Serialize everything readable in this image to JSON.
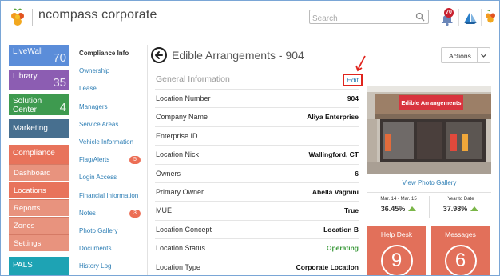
{
  "header": {
    "brand": "ncompass corporate",
    "search_placeholder": "Search",
    "notification_count": "70"
  },
  "nav_tiles": [
    {
      "label": "LiveWall",
      "count": "70",
      "color": "#5b8dd9"
    },
    {
      "label": "Library",
      "count": "35",
      "color": "#8c5db2"
    },
    {
      "label": "Solution Center",
      "count": "4",
      "color": "#3e9a4f"
    },
    {
      "label": "Marketing",
      "count": "",
      "color": "#476f8f"
    },
    {
      "label": "Compliance",
      "count": "",
      "color": "#e8735b"
    },
    {
      "label": "PALS",
      "count": "",
      "color": "#1ea3b4"
    }
  ],
  "compliance_subitems": [
    "Dashboard",
    "Locations",
    "Reports",
    "Zones",
    "Settings"
  ],
  "subnav": [
    {
      "label": "Compliance Info",
      "count": ""
    },
    {
      "label": "Ownership",
      "count": ""
    },
    {
      "label": "Lease",
      "count": ""
    },
    {
      "label": "Managers",
      "count": ""
    },
    {
      "label": "Service Areas",
      "count": ""
    },
    {
      "label": "Vehicle Information",
      "count": ""
    },
    {
      "label": "Flag/Alerts",
      "count": "5"
    },
    {
      "label": "Login Access",
      "count": ""
    },
    {
      "label": "Financial Information",
      "count": ""
    },
    {
      "label": "Notes",
      "count": "3"
    },
    {
      "label": "Photo Gallery",
      "count": ""
    },
    {
      "label": "Documents",
      "count": ""
    },
    {
      "label": "History Log",
      "count": ""
    }
  ],
  "main": {
    "title": "Edible Arrangements - 904",
    "actions_label": "Actions",
    "section_title": "General Information",
    "edit_label": "Edit",
    "fields": [
      {
        "key": "Location Number",
        "value": "904"
      },
      {
        "key": "Company Name",
        "value": "Aliya Enterprise"
      },
      {
        "key": "Enterprise ID",
        "value": ""
      },
      {
        "key": "Location Nick",
        "value": "Wallingford, CT"
      },
      {
        "key": "Owners",
        "value": "6"
      },
      {
        "key": "Primary Owner",
        "value": "Abella Vagnini"
      },
      {
        "key": "MUE",
        "value": "True"
      },
      {
        "key": "Location Concept",
        "value": "Location B"
      },
      {
        "key": "Location Status",
        "value": "Operating"
      },
      {
        "key": "Location Type",
        "value": "Corporate Location"
      }
    ]
  },
  "right": {
    "store_sign": "Edible Arrangements",
    "gallery_link": "View Photo Gallery",
    "stats": [
      {
        "label": "Mar. 14 - Mar. 15",
        "value": "36.45%"
      },
      {
        "label": "Year to Date",
        "value": "37.98%"
      }
    ],
    "cards": [
      {
        "label": "Help Desk",
        "count": "9"
      },
      {
        "label": "Messages",
        "count": "6"
      }
    ]
  }
}
